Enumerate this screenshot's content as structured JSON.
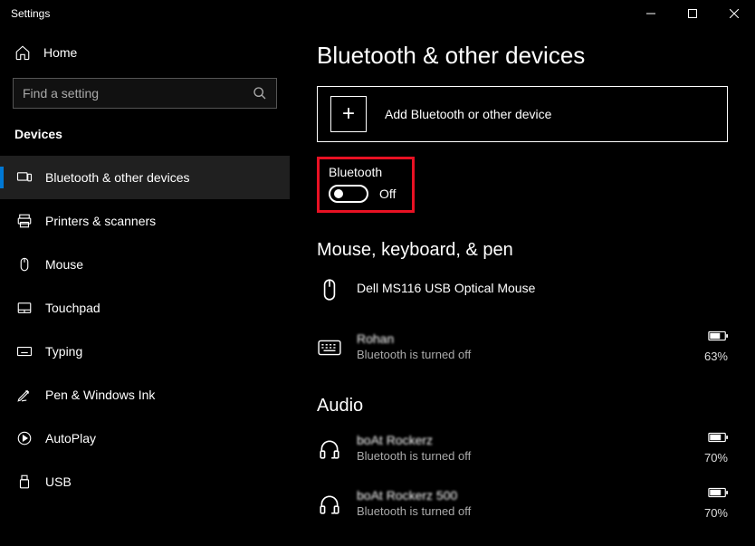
{
  "window": {
    "title": "Settings"
  },
  "sidebar": {
    "home": "Home",
    "search_placeholder": "Find a setting",
    "category": "Devices",
    "items": [
      {
        "label": "Bluetooth & other devices"
      },
      {
        "label": "Printers & scanners"
      },
      {
        "label": "Mouse"
      },
      {
        "label": "Touchpad"
      },
      {
        "label": "Typing"
      },
      {
        "label": "Pen & Windows Ink"
      },
      {
        "label": "AutoPlay"
      },
      {
        "label": "USB"
      }
    ]
  },
  "main": {
    "title": "Bluetooth & other devices",
    "add_label": "Add Bluetooth or other device",
    "bluetooth": {
      "label": "Bluetooth",
      "state": "Off"
    },
    "sections": {
      "mouse": {
        "heading": "Mouse, keyboard, & pen",
        "devices": [
          {
            "name": "Dell MS116 USB Optical Mouse",
            "status": ""
          },
          {
            "name": "Rohan",
            "status": "Bluetooth is turned off",
            "battery": "63%"
          }
        ]
      },
      "audio": {
        "heading": "Audio",
        "devices": [
          {
            "name": "boAt Rockerz",
            "status": "Bluetooth is turned off",
            "battery": "70%"
          },
          {
            "name": "boAt Rockerz 500",
            "status": "Bluetooth is turned off",
            "battery": "70%"
          }
        ]
      }
    }
  }
}
